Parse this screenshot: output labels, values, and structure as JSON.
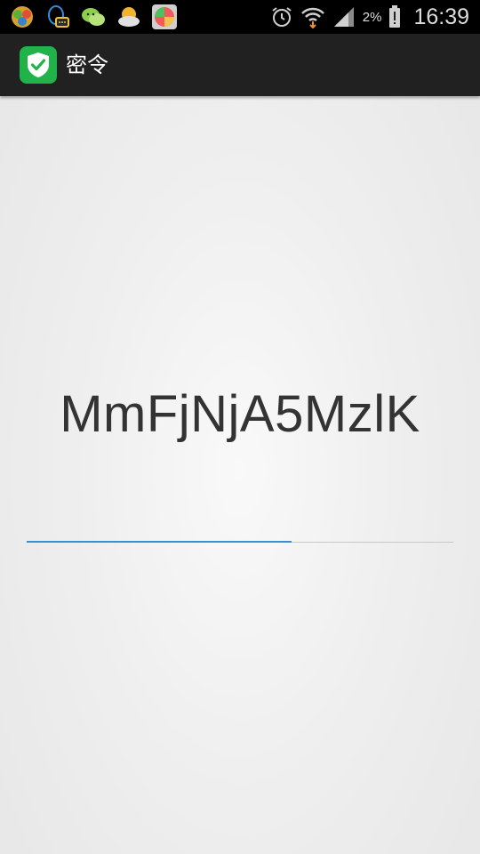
{
  "status_bar": {
    "notification_icons": [
      "game-center-icon",
      "qq-icon",
      "wechat-icon",
      "weather-icon",
      "ball-app-icon"
    ],
    "system_icons": [
      "alarm-icon",
      "wifi-icon",
      "signal-icon",
      "battery-icon"
    ],
    "battery_percent": "2%",
    "time": "16:39"
  },
  "action_bar": {
    "title": "密令",
    "logo_color": "#21b24a"
  },
  "token": {
    "code": "MmFjNjA5MzlK",
    "progress": 0.62
  },
  "colors": {
    "accent": "#3a8fd0",
    "text": "#333333"
  }
}
